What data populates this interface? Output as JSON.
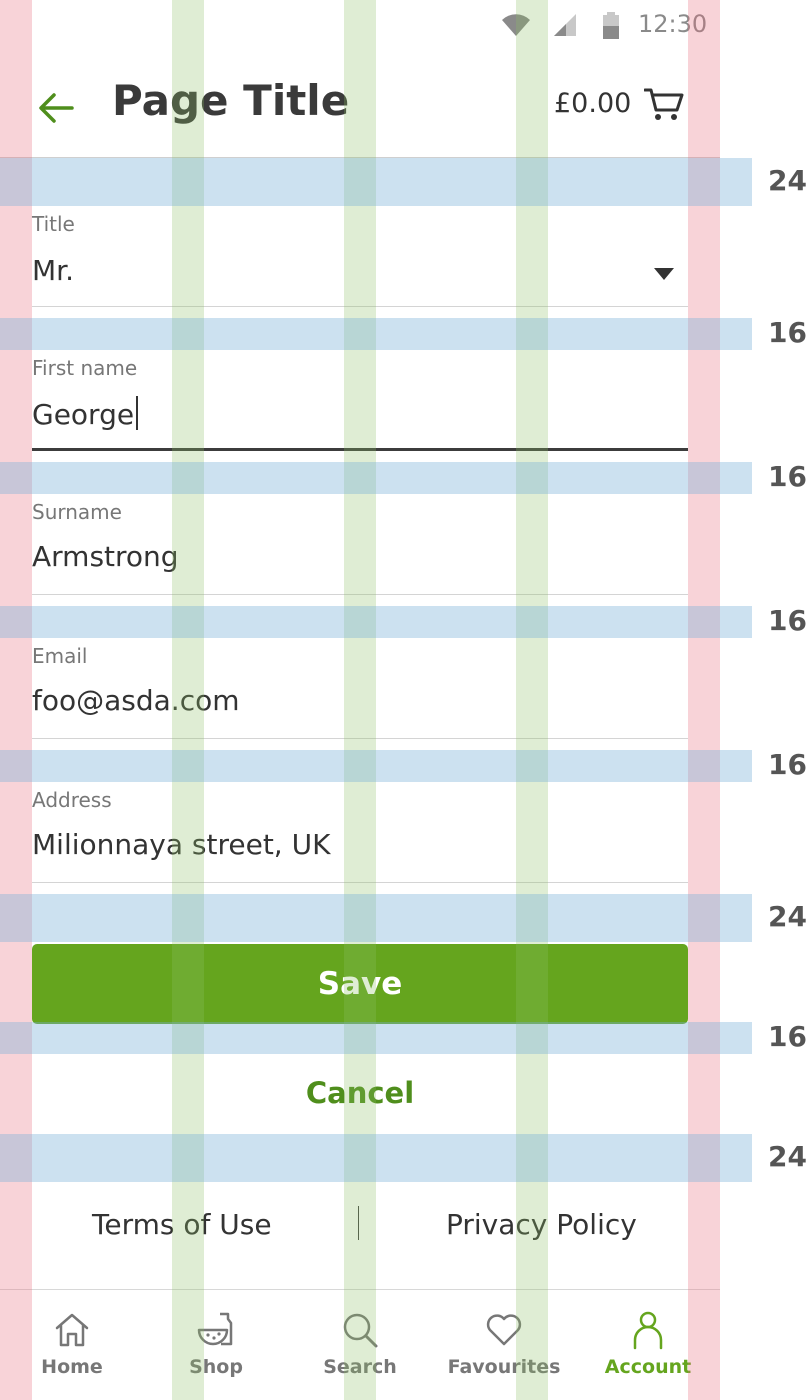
{
  "status_bar": {
    "time": "12:30",
    "icons": [
      "wifi-icon",
      "cellular-signal-icon",
      "battery-icon"
    ]
  },
  "header": {
    "title": "Page Title",
    "cart_total": "£0.00",
    "icons": [
      "back-arrow-icon",
      "shopping-cart-icon"
    ]
  },
  "form": {
    "title": {
      "label": "Title",
      "value": "Mr."
    },
    "first_name": {
      "label": "First name",
      "value": "George"
    },
    "surname": {
      "label": "Surname",
      "value": "Armstrong"
    },
    "email": {
      "label": "Email",
      "value": "foo@asda.com"
    },
    "address": {
      "label": "Address",
      "value": "Milionnaya street, UK"
    }
  },
  "actions": {
    "save_label": "Save",
    "cancel_label": "Cancel"
  },
  "footer": {
    "terms_label": "Terms of Use",
    "privacy_label": "Privacy Policy"
  },
  "bottom_nav": {
    "items": [
      {
        "label": "Home",
        "icon": "home-icon"
      },
      {
        "label": "Shop",
        "icon": "shop-icon"
      },
      {
        "label": "Search",
        "icon": "search-icon"
      },
      {
        "label": "Favourites",
        "icon": "heart-icon"
      },
      {
        "label": "Account",
        "icon": "account-icon"
      }
    ],
    "active": "Account"
  },
  "spacing_labels": [
    "24",
    "16",
    "16",
    "16",
    "16",
    "24",
    "16",
    "24"
  ],
  "colors": {
    "brand_green": "#65a51e",
    "link_green": "#4f8e1c",
    "text": "#333333",
    "muted": "#777777"
  }
}
